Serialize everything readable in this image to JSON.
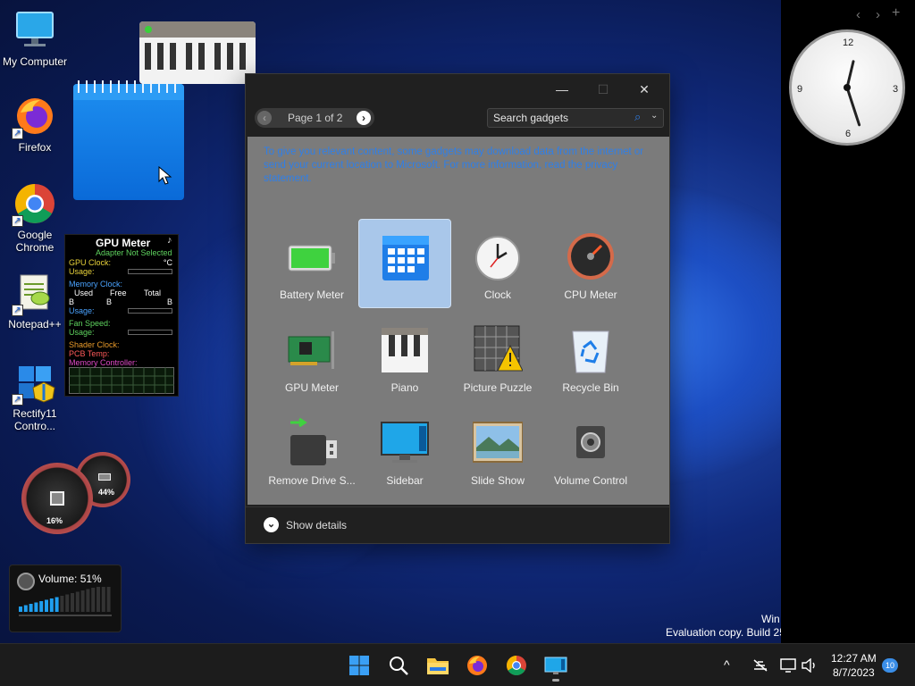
{
  "desktop": {
    "icons": [
      {
        "label": "My Computer"
      },
      {
        "label": "Firefox"
      },
      {
        "label": "Google Chrome"
      },
      {
        "label": "Notepad++"
      },
      {
        "label": "Rectify11 Contro..."
      }
    ]
  },
  "gpu_meter": {
    "title": "GPU Meter",
    "subtitle": "Adapter Not Selected",
    "gpu_clock": "GPU Clock:",
    "unit_c": "°C",
    "usage": "Usage:",
    "memory_clock": "Memory Clock:",
    "col_used": "Used",
    "col_free": "Free",
    "col_total": "Total",
    "b": "B",
    "fan_speed": "Fan Speed:",
    "shader_clock": "Shader Clock:",
    "pcb_temp": "PCB Temp:",
    "memory_controller": "Memory Controller:"
  },
  "cpu_meter_widget": {
    "cpu_percent": "16%",
    "memory_percent": "44%"
  },
  "volume_widget": {
    "label": "Volume: 51%",
    "level": 0.51
  },
  "clock_widget": {
    "n12": "12",
    "n3": "3",
    "n6": "6",
    "n9": "9",
    "time": "12:27"
  },
  "sidebar": {
    "prev": "‹",
    "next": "›"
  },
  "dialog": {
    "title_min": "—",
    "title_max": "☐",
    "title_close": "✕",
    "pager_label": "Page 1 of 2",
    "pager_prev": "‹",
    "pager_next": "›",
    "search_placeholder": "Search gadgets",
    "privacy_text": "To give you relevant content, some gadgets may download data from the internet or send your current location to Microsoft. For more information, read the privacy statement.",
    "gadgets": [
      {
        "label": "Battery Meter",
        "icon": "battery-icon"
      },
      {
        "label": "Calendar",
        "icon": "calendar-icon",
        "selected": true
      },
      {
        "label": "Clock",
        "icon": "clock-icon"
      },
      {
        "label": "CPU Meter",
        "icon": "gauge-icon"
      },
      {
        "label": "GPU Meter",
        "icon": "graphics-card-icon"
      },
      {
        "label": "Piano",
        "icon": "piano-icon"
      },
      {
        "label": "Picture Puzzle",
        "icon": "puzzle-icon"
      },
      {
        "label": "Recycle Bin",
        "icon": "recycle-bin-icon"
      },
      {
        "label": "Remove Drive S...",
        "icon": "usb-drive-icon"
      },
      {
        "label": "Sidebar",
        "icon": "monitor-icon"
      },
      {
        "label": "Slide Show",
        "icon": "photo-icon"
      },
      {
        "label": "Volume Control",
        "icon": "speaker-icon"
      }
    ],
    "show_details": "Show details"
  },
  "watermark": {
    "line1": "Win",
    "line2": "Evaluation copy. Build 25"
  },
  "taskbar": {
    "time": "12:27 AM",
    "date": "8/7/2023",
    "notification_count": "10",
    "chevron": "^"
  },
  "colors": {
    "accent": "#2f7fe8",
    "taskbar": "#1c1c1c",
    "dialog": "#202020",
    "gallery": "#7b7b7b",
    "selection": "#a9c7ea"
  }
}
